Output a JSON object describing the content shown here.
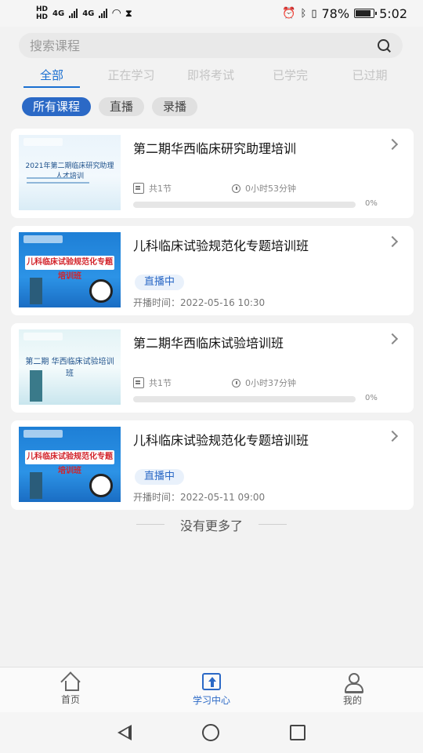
{
  "status_bar": {
    "left_labels": [
      "HD",
      "HD",
      "4G",
      "4G"
    ],
    "battery": "78%",
    "time": "5:02",
    "icons": [
      "alarm-icon",
      "bluetooth-icon",
      "vibrate-icon",
      "battery-icon"
    ]
  },
  "search": {
    "placeholder": "搜索课程"
  },
  "tabs": [
    {
      "label": "全部",
      "active": true
    },
    {
      "label": "正在学习",
      "active": false
    },
    {
      "label": "即将考试",
      "active": false
    },
    {
      "label": "已学完",
      "active": false
    },
    {
      "label": "已过期",
      "active": false
    }
  ],
  "filters": [
    {
      "label": "所有课程",
      "active": true
    },
    {
      "label": "直播",
      "active": false
    },
    {
      "label": "录播",
      "active": false
    }
  ],
  "courses": [
    {
      "title": "第二期华西临床研究助理培训",
      "lessons": "共1节",
      "duration": "0小时53分钟",
      "progress_pct": "0%",
      "progress": 0,
      "thumb_text": "2021年第二期临床研究助理人才培训"
    },
    {
      "title": "儿科临床试验规范化专题培训班",
      "badge": "直播中",
      "time": "开播时间：2022-05-16 10:30",
      "thumb_text": "儿科临床试验规范化专题培训班"
    },
    {
      "title": "第二期华西临床试验培训班",
      "lessons": "共1节",
      "duration": "0小时37分钟",
      "progress_pct": "0%",
      "progress": 0,
      "thumb_text": "第二期 华西临床试验培训班"
    },
    {
      "title": "儿科临床试验规范化专题培训班",
      "badge": "直播中",
      "time": "开播时间：2022-05-11 09:00",
      "thumb_text": "儿科临床试验规范化专题培训班"
    }
  ],
  "footer_note": "没有更多了",
  "bottom_nav": [
    {
      "label": "首页",
      "icon": "home-icon",
      "active": false
    },
    {
      "label": "学习中心",
      "icon": "study-icon",
      "active": true
    },
    {
      "label": "我的",
      "icon": "user-icon",
      "active": false
    }
  ],
  "colors": {
    "accent": "#2b69c6",
    "tab_active": "#1a6fd1",
    "background": "#f2f2f2"
  }
}
